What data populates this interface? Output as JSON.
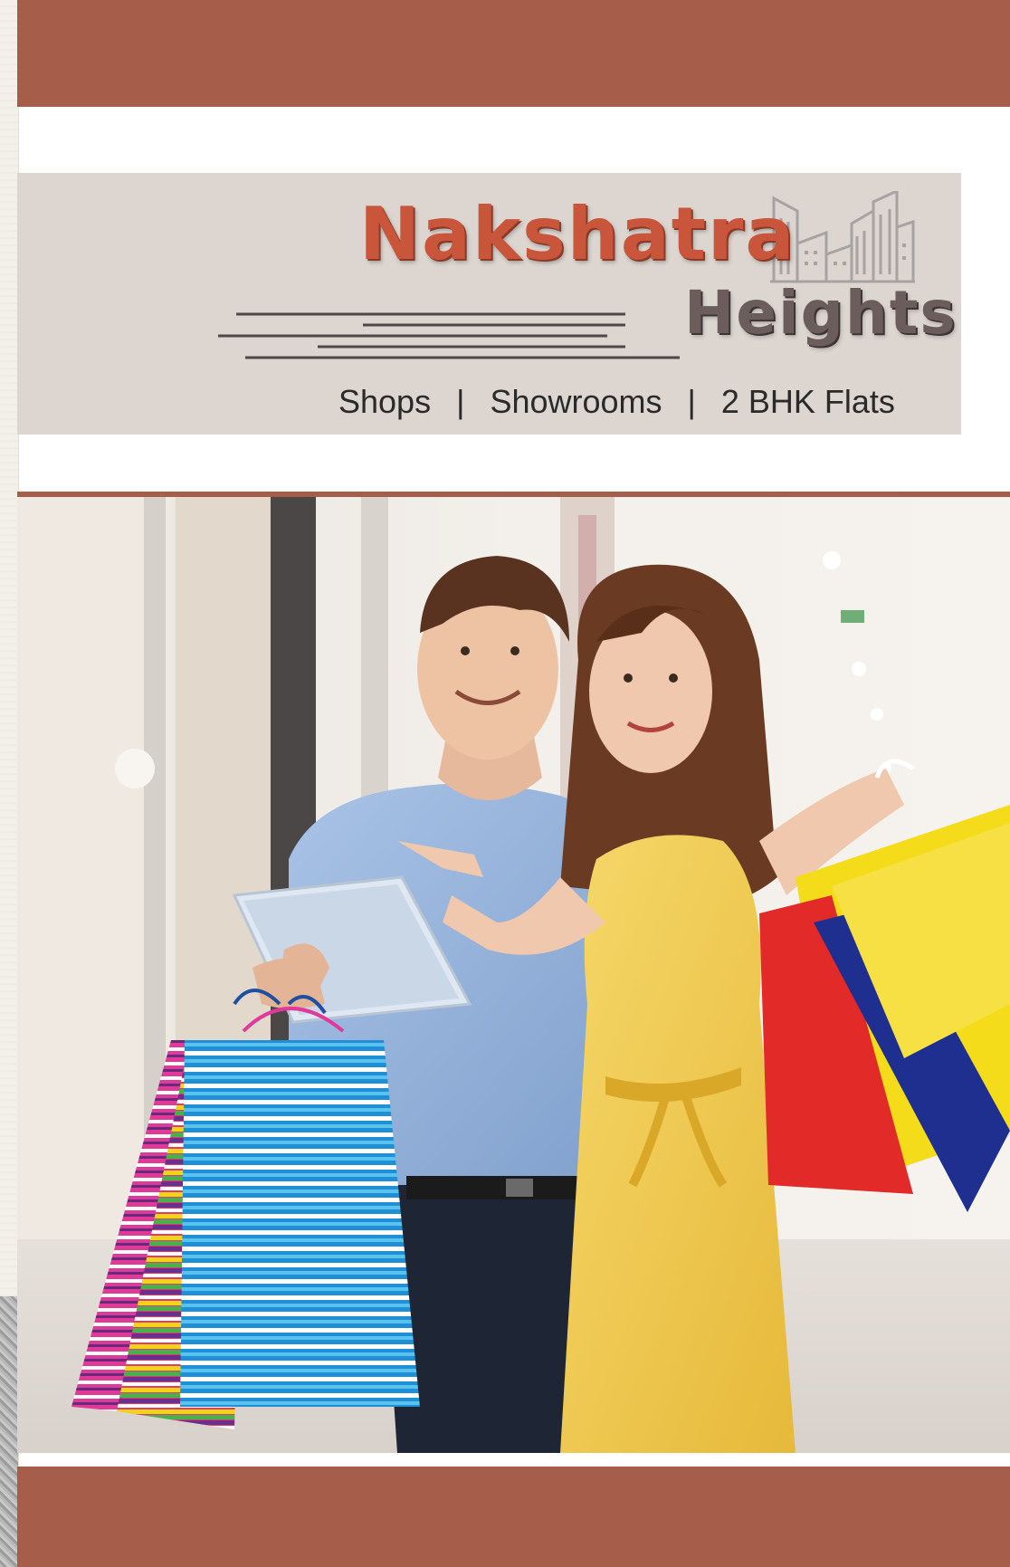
{
  "brand": {
    "name": "Nakshatra",
    "subname": "Heights",
    "offerings": [
      "Shops",
      "Showrooms",
      "2 BHK Flats"
    ]
  },
  "colors": {
    "band": "#a65e4b",
    "logo_panel": "#dcd5d0",
    "brand_red": "#c9553a",
    "brand_grey": "#6a5d5c"
  },
  "icons": {
    "skyline": "building-skyline-icon"
  },
  "photo": {
    "alt": "shopping-couple-photo"
  }
}
